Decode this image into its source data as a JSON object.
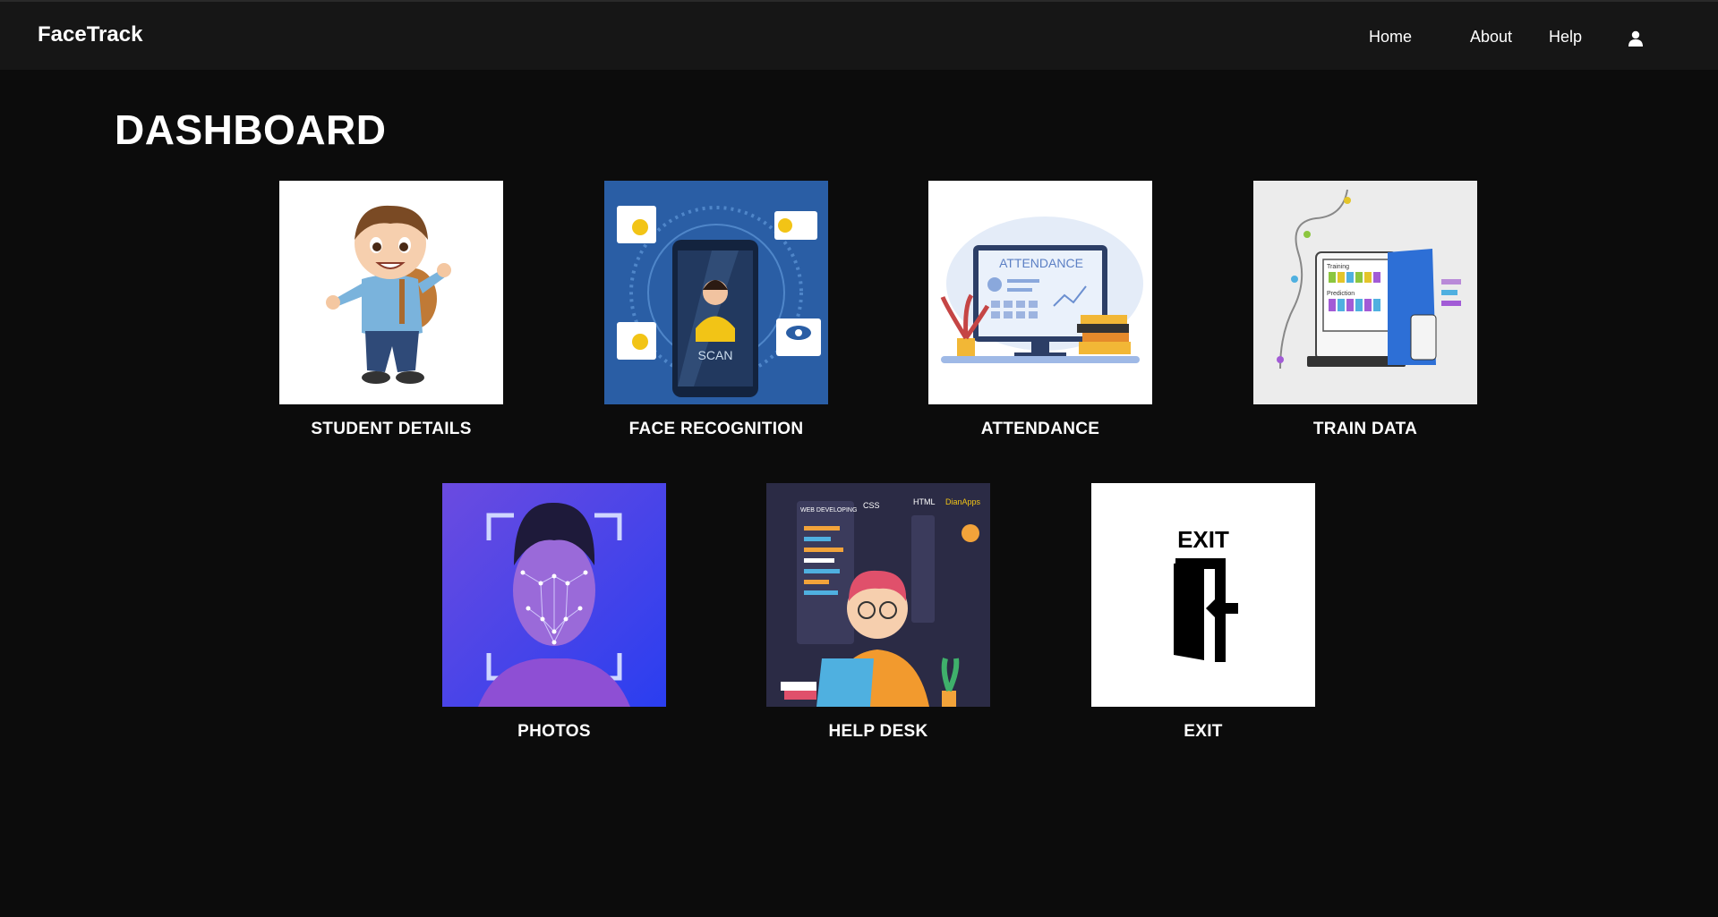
{
  "app": {
    "brand": "FaceTrack"
  },
  "nav": {
    "home": "Home",
    "about": "About",
    "help": "Help"
  },
  "page": {
    "title": "DASHBOARD"
  },
  "tiles": [
    {
      "label": "STUDENT DETAILS",
      "image": "student-illustration"
    },
    {
      "label": "FACE RECOGNITION",
      "image": "face-scan-phone-illustration"
    },
    {
      "label": "ATTENDANCE",
      "image": "attendance-monitor-illustration"
    },
    {
      "label": "TRAIN DATA",
      "image": "training-computer-illustration"
    },
    {
      "label": "PHOTOS",
      "image": "face-mesh-illustration"
    },
    {
      "label": "HELP DESK",
      "image": "web-developer-illustration"
    },
    {
      "label": "EXIT",
      "image": "exit-door-icon",
      "thumb_text": "EXIT"
    }
  ],
  "images": {
    "attendance_screen_text": "ATTENDANCE",
    "face_scan_text": "SCAN",
    "helpdesk_tags": [
      "WEB DEVELOPING",
      "CSS",
      "HTML",
      "DianApps"
    ],
    "train_labels": [
      "Training",
      "Prediction"
    ]
  },
  "colors": {
    "background": "#0c0c0c",
    "navbar": "#161616",
    "face_recognition_bg": "#2a5ea5",
    "photos_bg": "#4b45e6",
    "helpdesk_bg": "#2b2b45"
  }
}
